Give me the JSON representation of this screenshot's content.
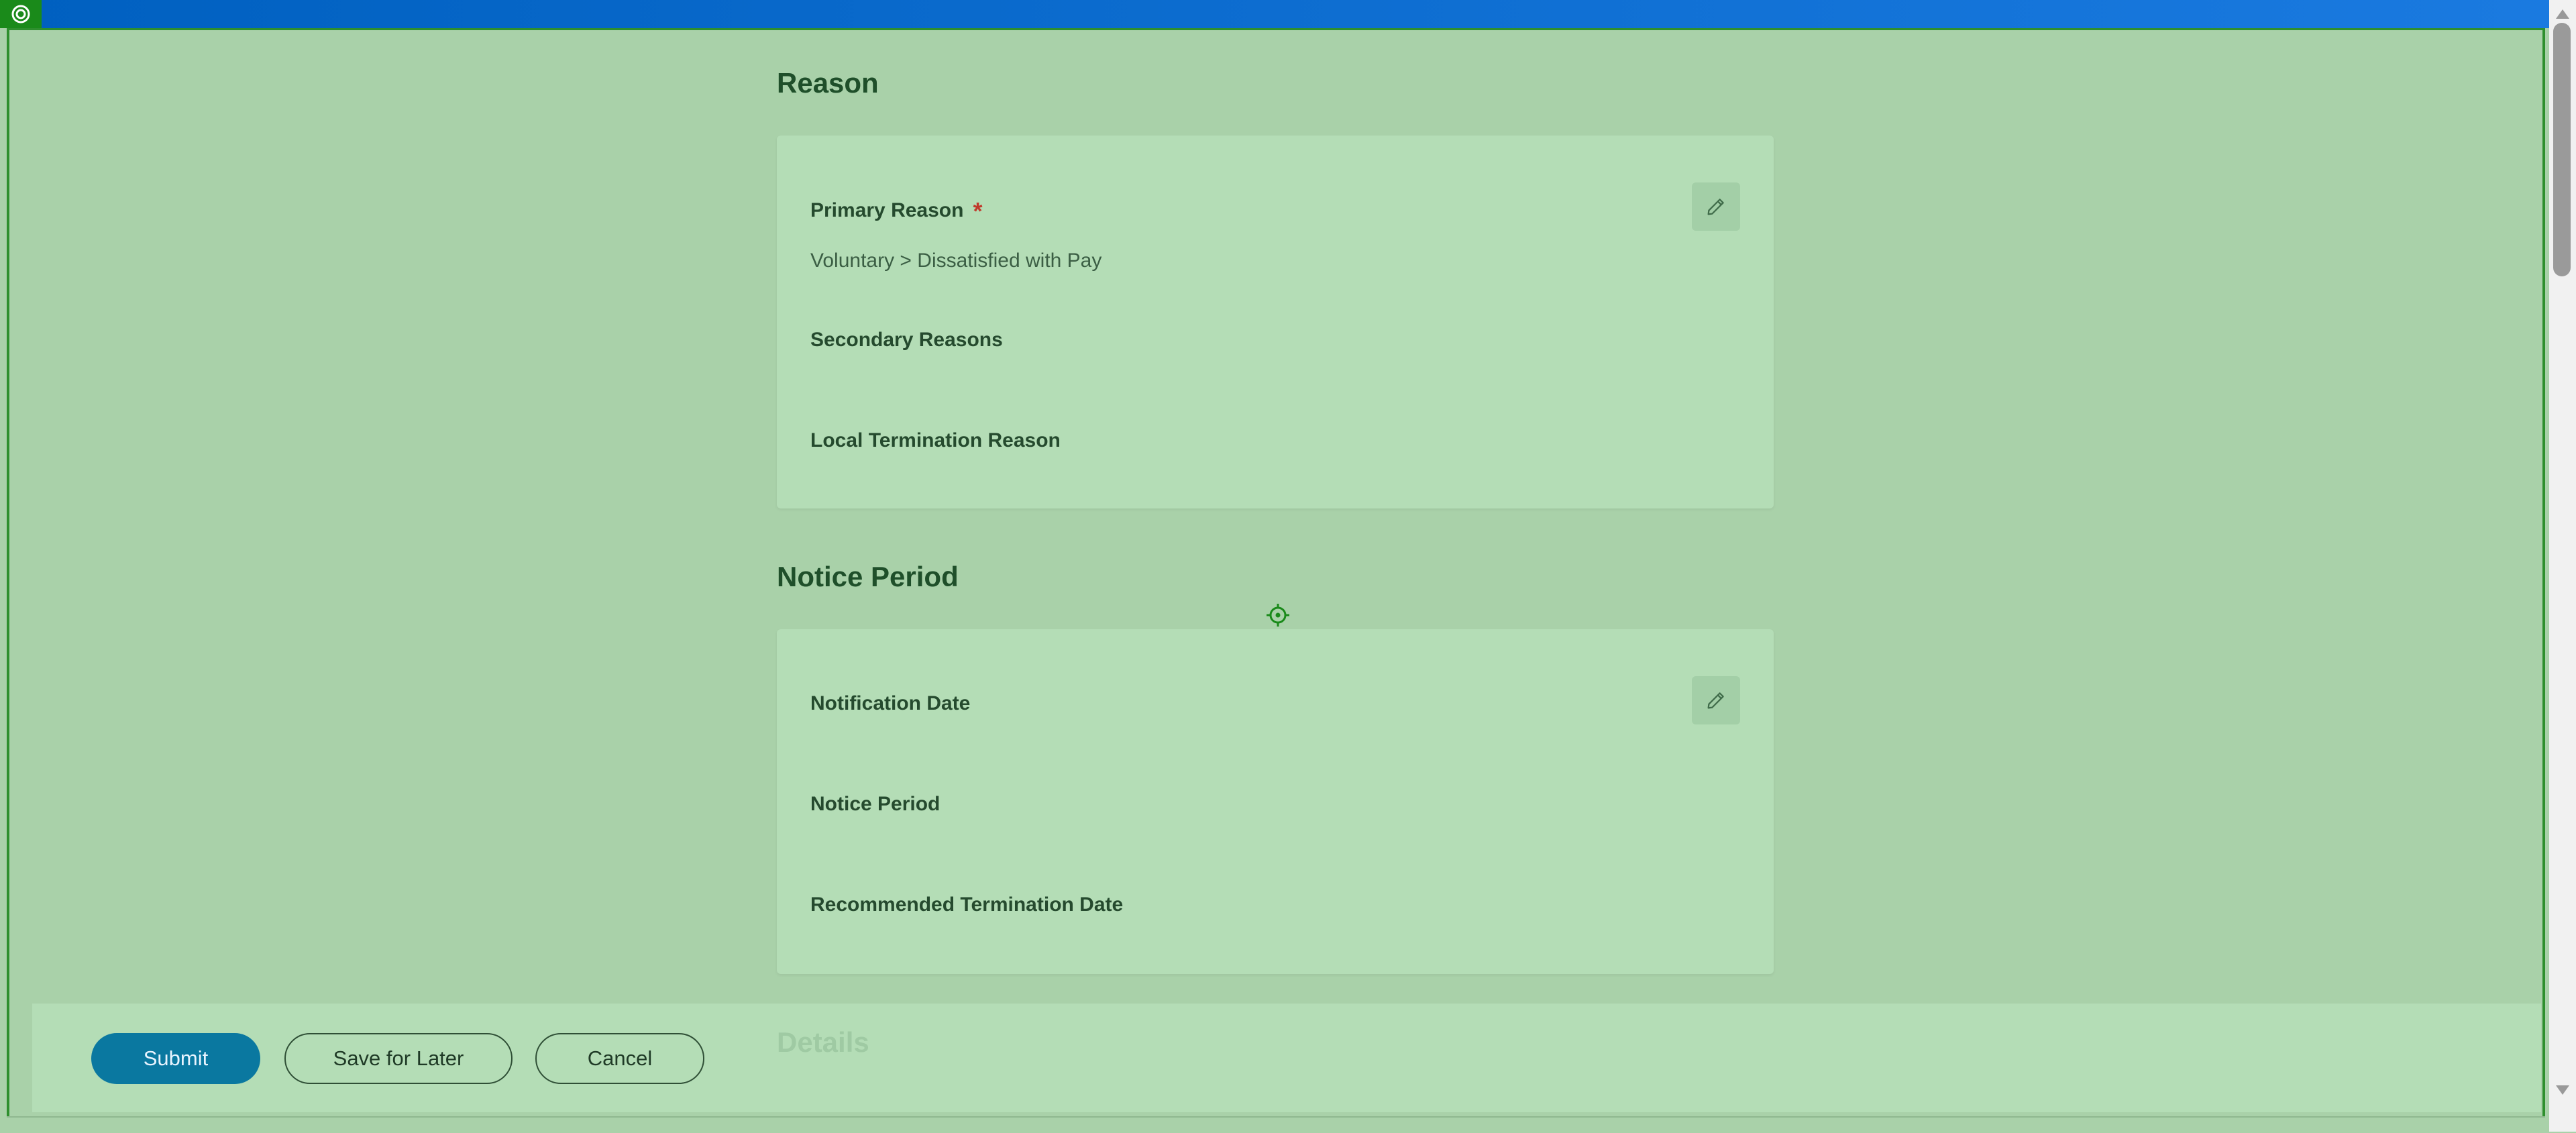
{
  "sections": {
    "reason": {
      "title": "Reason",
      "fields": {
        "primary_reason": {
          "label": "Primary Reason",
          "required_mark": "*",
          "value": "Voluntary > Dissatisfied with Pay"
        },
        "secondary_reasons": {
          "label": "Secondary Reasons"
        },
        "local_termination_reason": {
          "label": "Local Termination Reason"
        }
      }
    },
    "notice_period": {
      "title": "Notice Period",
      "fields": {
        "notification_date": {
          "label": "Notification Date"
        },
        "notice_period": {
          "label": "Notice Period"
        },
        "recommended_termination_date": {
          "label": "Recommended Termination Date"
        }
      }
    },
    "details": {
      "title": "Details"
    }
  },
  "footer": {
    "submit_label": "Submit",
    "save_for_later_label": "Save for Later",
    "cancel_label": "Cancel"
  },
  "icons": {
    "badge": "target-icon",
    "edit": "pencil-icon",
    "crosshair": "crosshair-icon"
  },
  "colors": {
    "overlay": "#a9d1a9",
    "card": "#b4ddb6",
    "primary_button": "#0a78a0",
    "required": "#c0392b",
    "topbar": "#0060c0"
  }
}
